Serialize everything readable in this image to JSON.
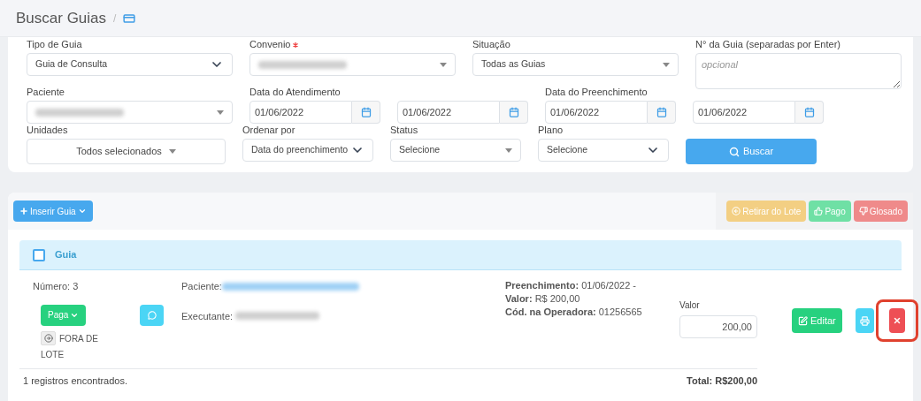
{
  "header": {
    "title": "Buscar Guias",
    "separator": "/"
  },
  "filters": {
    "row_1": [
      {
        "kind": "select",
        "label": "Tipo de Guia",
        "value": "Guia de Consulta"
      },
      {
        "kind": "combo",
        "label": "Convenio",
        "required": true,
        "value_redacted": true
      },
      {
        "kind": "combo",
        "label": "Situação",
        "value": "Todas as Guias"
      },
      {
        "kind": "textarea",
        "label": "N° da Guia (separadas por Enter)",
        "placeholder": "opcional"
      }
    ],
    "row_2": [
      {
        "kind": "combo",
        "label": "Paciente",
        "value_redacted": true
      },
      {
        "kind": "date",
        "label": "Data do Atendimento",
        "value": "01/06/2022"
      },
      {
        "kind": "date",
        "value": "01/06/2022"
      },
      {
        "kind": "date",
        "label": "Data do Preenchimento",
        "value": "01/06/2022"
      },
      {
        "kind": "date",
        "value": "01/06/2022"
      }
    ],
    "row_3": [
      {
        "kind": "multiselect",
        "label": "Unidades",
        "value": "Todos selecionados"
      },
      {
        "kind": "select",
        "label": "Ordenar por",
        "value": "Data do preenchimento"
      },
      {
        "kind": "combo",
        "label": "Status",
        "value": "Selecione"
      },
      {
        "kind": "select",
        "label": "Plano",
        "value": "Selecione"
      },
      {
        "kind": "button",
        "text": "Buscar"
      }
    ]
  },
  "toolbar": {
    "insert_button": "Inserir Guia",
    "actions": [
      {
        "label": "Retirar do Lote",
        "color": "#f3cf83"
      },
      {
        "label": "Pago",
        "color": "#6fe0a5"
      },
      {
        "label": "Glosado",
        "color": "#ef8a8a"
      }
    ]
  },
  "list": {
    "header": {
      "label": "Guia",
      "checked": false
    },
    "rows": [
      {
        "numero": "Número: 3",
        "status": "Paga",
        "lote": "FORA DE LOTE",
        "paciente_label": "Paciente:",
        "paciente_redacted": true,
        "executante_label": "Executante:",
        "executante_redacted": true,
        "details": [
          "**Preenchimento:** 01/06/2022 -",
          "**Valor:** R$ 200,00",
          "**Cód. na Operadora:** 01256565"
        ],
        "valor_label": "Valor",
        "valor": "200,00",
        "edit_button": "Editar",
        "delete_highlighted": true
      }
    ],
    "footer": {
      "count": "1 registros encontrados.",
      "total": "Total: R$200,00"
    }
  }
}
